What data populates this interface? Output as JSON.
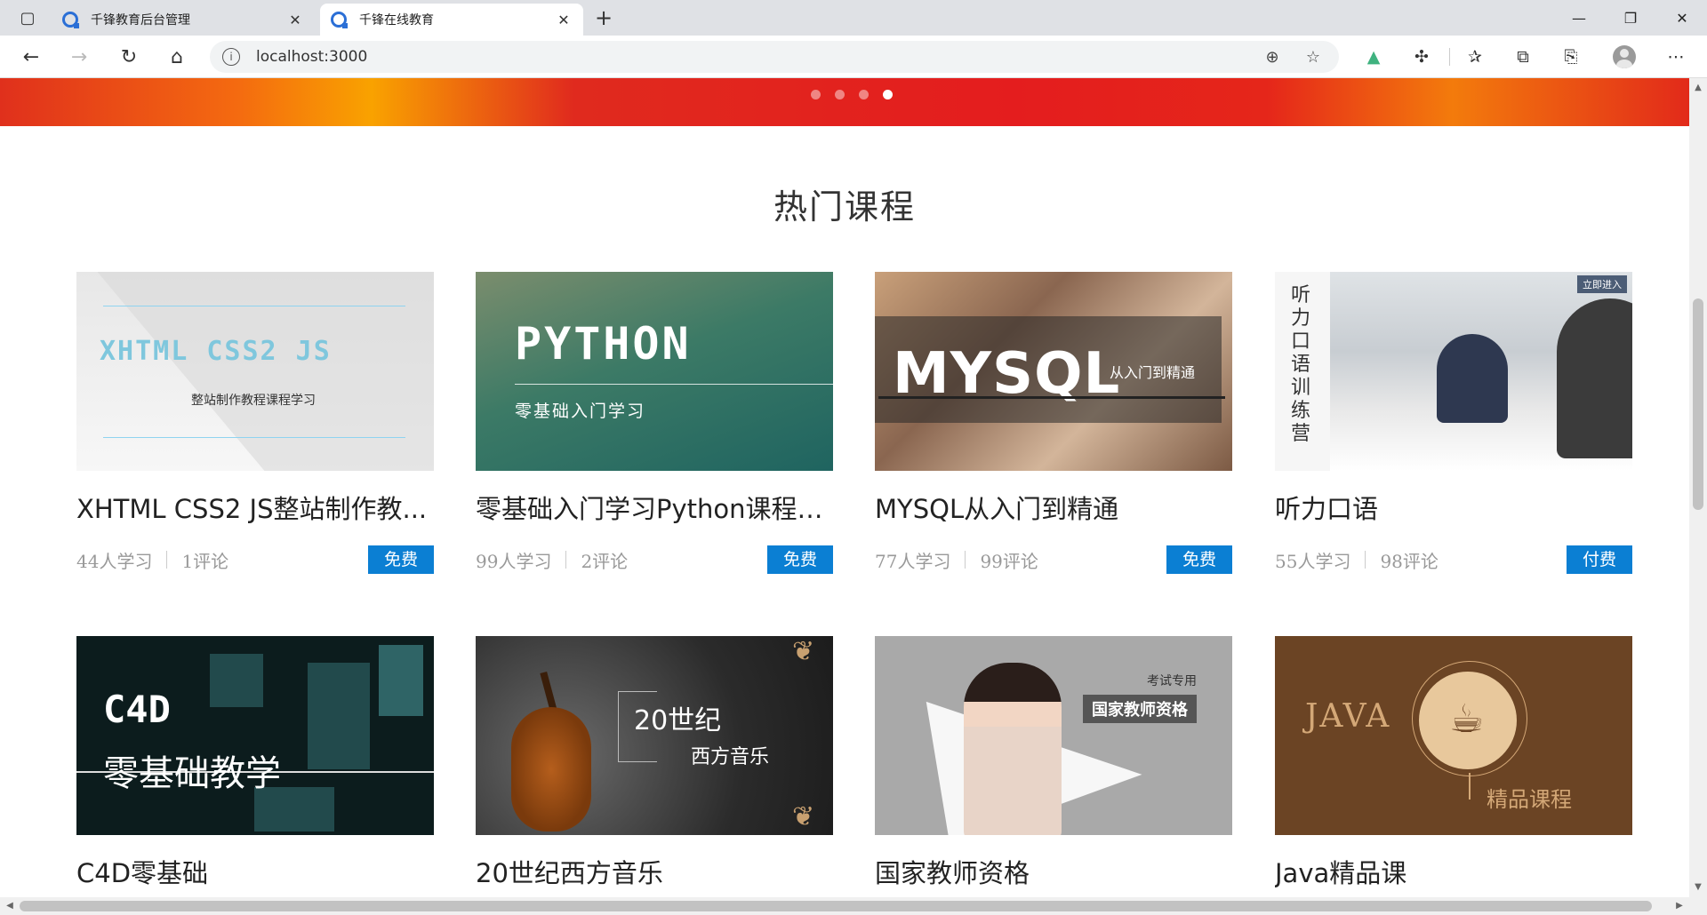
{
  "browser": {
    "tabs": [
      {
        "title": "千锋教育后台管理",
        "active": false
      },
      {
        "title": "千锋在线教育",
        "active": true
      }
    ],
    "url": "localhost:3000",
    "icons": {
      "tab_actions": "tab-actions-icon",
      "close": "close-icon",
      "new_tab": "plus-icon",
      "back": "back-arrow-icon",
      "forward": "forward-arrow-icon",
      "reload": "reload-icon",
      "home": "home-icon",
      "site_info": "info-icon",
      "zoom": "zoom-icon",
      "add_favorite": "add-favorite-icon",
      "vue_devtools": "vue-icon",
      "extensions": "puzzle-icon",
      "favorites": "favorites-icon",
      "collections": "collections-icon",
      "screenshot": "screenshot-icon",
      "profile": "profile-avatar-icon",
      "more": "more-icon"
    }
  },
  "banner": {
    "dots": 4,
    "active_dot": 3
  },
  "section": {
    "title": "热门课程"
  },
  "courses": [
    {
      "title": "XHTML CSS2 JS整站制作教...",
      "learners": "44人学习",
      "comments": "1评论",
      "price": "免费",
      "cover": {
        "main": "XHTML   CSS2   JS",
        "sub": "整站制作教程课程学习"
      }
    },
    {
      "title": "零基础入门学习Python课程学习",
      "learners": "99人学习",
      "comments": "2评论",
      "price": "免费",
      "cover": {
        "main": "PYTHON",
        "sub": "零基础入门学习"
      }
    },
    {
      "title": "MYSQL从入门到精通",
      "learners": "77人学习",
      "comments": "99评论",
      "price": "免费",
      "cover": {
        "main": "MYSQL",
        "sub": "从入门到精通"
      }
    },
    {
      "title": "听力口语",
      "learners": "55人学习",
      "comments": "98评论",
      "price": "付费",
      "cover": {
        "main": "听力口语训练营",
        "sub": "立即进入"
      }
    },
    {
      "title": "C4D零基础",
      "cover": {
        "main": "C4D",
        "sub": "零基础教学"
      }
    },
    {
      "title": "20世纪西方音乐",
      "cover": {
        "main": "20世纪",
        "sub": "西方音乐"
      }
    },
    {
      "title": "国家教师资格",
      "cover": {
        "main": "国家教师资格",
        "sub": "考试专用"
      }
    },
    {
      "title": "Java精品课",
      "cover": {
        "main": "JAVA",
        "sub": "精品课程"
      }
    }
  ]
}
